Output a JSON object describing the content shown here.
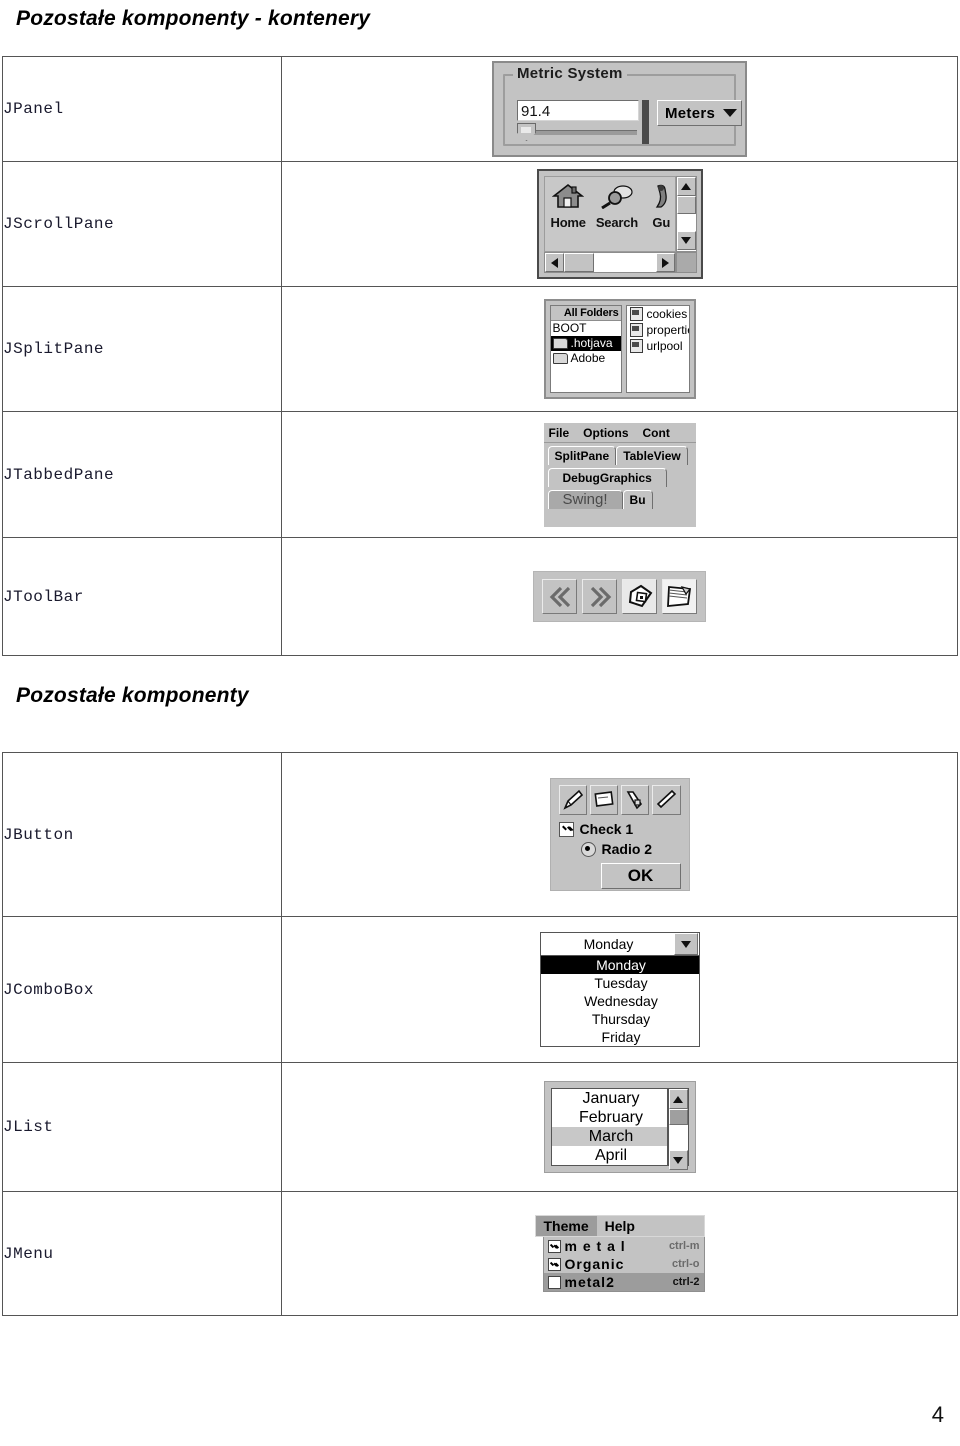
{
  "title_1": "Pozostałe komponenty - kontenery",
  "title_2": "Pozostałe komponenty",
  "page_number": "4",
  "containers_table": {
    "rows": [
      {
        "label": "JPanel"
      },
      {
        "label": "JScrollPane"
      },
      {
        "label": "JSplitPane"
      },
      {
        "label": "JTabbedPane"
      },
      {
        "label": "JToolBar"
      }
    ]
  },
  "components_table": {
    "rows": [
      {
        "label": "JButton"
      },
      {
        "label": "JComboBox"
      },
      {
        "label": "JList"
      },
      {
        "label": "JMenu"
      }
    ]
  },
  "jpanel_shot": {
    "border_title": "Metric System",
    "textfield_value": "91.4",
    "combo_value": "Meters",
    "arrow_icon": "chevron-down-icon"
  },
  "jscrollpane_shot": {
    "items": [
      {
        "label": "Home",
        "icon": "house-icon"
      },
      {
        "label": "Search",
        "icon": "magnifier-icon"
      },
      {
        "label": "Gu",
        "icon": "guide-icon"
      }
    ],
    "scroll_up_icon": "triangle-up-icon",
    "scroll_down_icon": "triangle-down-icon",
    "scroll_left_icon": "triangle-left-icon",
    "scroll_right_icon": "triangle-right-icon"
  },
  "jsplitpane_shot": {
    "left_header": "All Folders",
    "left_items": [
      {
        "label": "BOOT",
        "has_folder": false,
        "selected": false
      },
      {
        "label": ".hotjava",
        "has_folder": true,
        "selected": true
      },
      {
        "label": "Adobe",
        "has_folder": true,
        "selected": false
      }
    ],
    "right_items": [
      {
        "label": "cookies"
      },
      {
        "label": "propertie"
      },
      {
        "label": "urlpool"
      }
    ]
  },
  "jtabbedpane_shot": {
    "menus": [
      "File",
      "Options",
      "Cont"
    ],
    "tabs_row1": [
      "SplitPane",
      "TableView"
    ],
    "tabs_row2": [
      "DebugGraphics"
    ],
    "tabs_row3": [
      {
        "label": "Swing!",
        "selected": true
      },
      {
        "label": "Bu",
        "selected": false
      }
    ]
  },
  "jtoolbar_shot": {
    "buttons": [
      {
        "icon": "back-double-chevron-icon"
      },
      {
        "icon": "forward-double-chevron-icon"
      },
      {
        "icon": "home-picture-icon"
      },
      {
        "icon": "pages-icon"
      }
    ]
  },
  "jbutton_shot": {
    "icon_buttons": [
      {
        "icon": "pencil-icon"
      },
      {
        "icon": "note-icon"
      },
      {
        "icon": "brush-icon"
      },
      {
        "icon": "page-icon"
      }
    ],
    "checkbox": {
      "label": "Check 1",
      "checked": true
    },
    "radio": {
      "label": "Radio 2",
      "selected": true
    },
    "ok_button": "OK"
  },
  "jcombobox_shot": {
    "value": "Monday",
    "arrow_icon": "triangle-down-icon",
    "options": [
      {
        "label": "Monday",
        "selected": true
      },
      {
        "label": "Tuesday",
        "selected": false
      },
      {
        "label": "Wednesday",
        "selected": false
      },
      {
        "label": "Thursday",
        "selected": false
      },
      {
        "label": "Friday",
        "selected": false
      }
    ]
  },
  "jlist_shot": {
    "items": [
      {
        "label": "January",
        "selected": false
      },
      {
        "label": "February",
        "selected": false
      },
      {
        "label": "March",
        "selected": true
      },
      {
        "label": "April",
        "selected": false
      }
    ],
    "scroll_up_icon": "triangle-up-icon",
    "scroll_down_icon": "triangle-down-icon"
  },
  "jmenu_shot": {
    "menubar": [
      {
        "label": "Theme",
        "selected": true
      },
      {
        "label": "Help",
        "selected": false
      }
    ],
    "items": [
      {
        "label": "m e t a l",
        "accelerator": "ctrl-m",
        "checked": true,
        "highlighted": false
      },
      {
        "label": "Organic",
        "accelerator": "ctrl-o",
        "checked": true,
        "highlighted": false
      },
      {
        "label": "metal2",
        "accelerator": "ctrl-2",
        "checked": false,
        "highlighted": true
      }
    ]
  }
}
